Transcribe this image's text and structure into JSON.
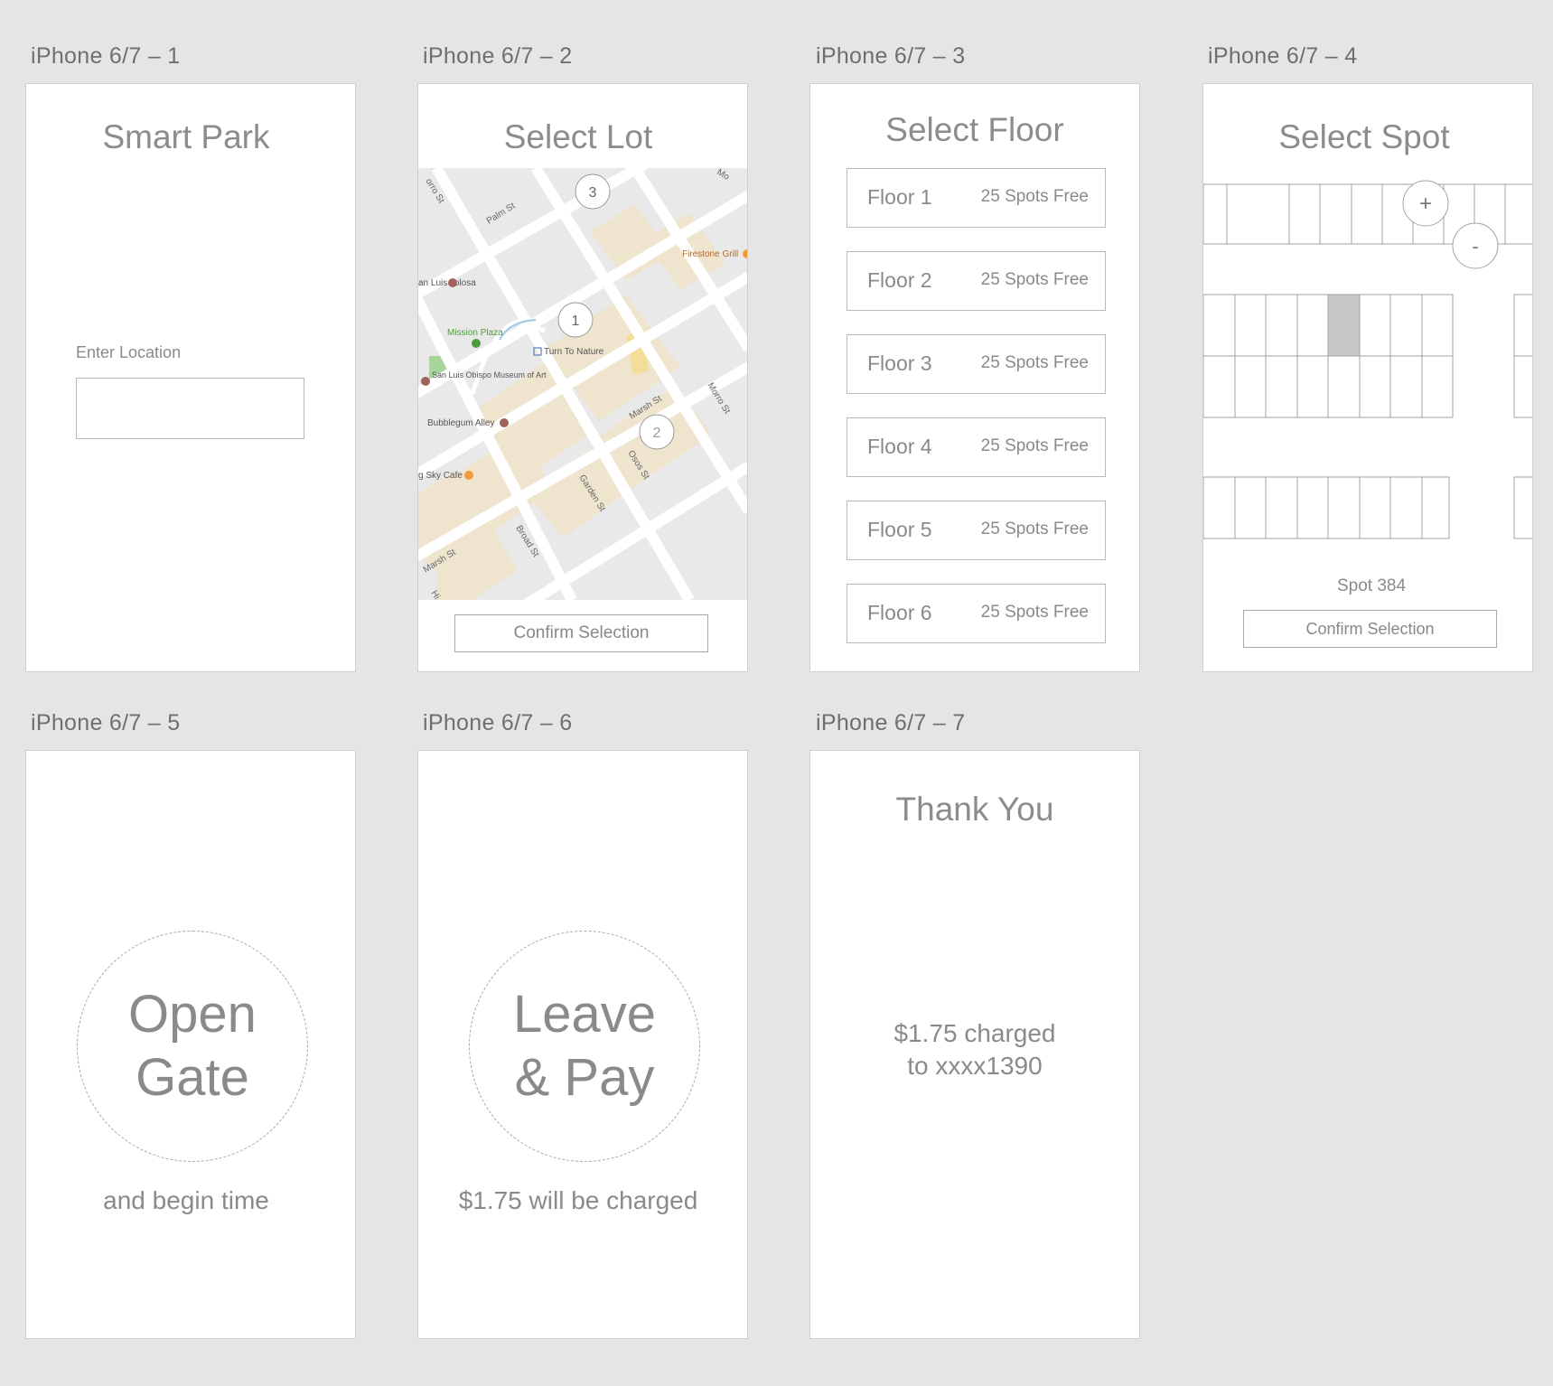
{
  "frames": {
    "f1": {
      "label": "iPhone 6/7 – 1",
      "title": "Smart Park",
      "location_label": "Enter Location",
      "location_value": ""
    },
    "f2": {
      "label": "iPhone 6/7 – 2",
      "title": "Select Lot",
      "confirm": "Confirm Selection",
      "map": {
        "lot_markers": [
          "3",
          "1",
          "2"
        ],
        "street_labels": [
          "orro St",
          "Palm St",
          "Mo",
          "Marsh St",
          "Morro St",
          "Garden St",
          "Broad St",
          "Osos St",
          "Marsh St",
          "Hi"
        ],
        "places": [
          "Firestone Grill",
          "an Luis Tolosa",
          "Mission Plaza",
          "Turn To Nature",
          "San Luis Obispo Museum of Art",
          "Bubblegum Alley",
          "g Sky Cafe"
        ]
      }
    },
    "f3": {
      "label": "iPhone 6/7 – 3",
      "title": "Select Floor",
      "floors": [
        {
          "name": "Floor 1",
          "free": "25 Spots Free"
        },
        {
          "name": "Floor 2",
          "free": "25 Spots Free"
        },
        {
          "name": "Floor 3",
          "free": "25 Spots Free"
        },
        {
          "name": "Floor 4",
          "free": "25 Spots Free"
        },
        {
          "name": "Floor 5",
          "free": "25 Spots Free"
        },
        {
          "name": "Floor 6",
          "free": "25 Spots Free"
        }
      ]
    },
    "f4": {
      "label": "iPhone 6/7 – 4",
      "title": "Select Spot",
      "zoom_in": "+",
      "zoom_out": "-",
      "spot": "Spot 384",
      "confirm": "Confirm Selection"
    },
    "f5": {
      "label": "iPhone 6/7 – 5",
      "button": "Open\nGate",
      "subtext": "and begin time"
    },
    "f6": {
      "label": "iPhone 6/7 – 6",
      "button": "Leave\n& Pay",
      "subtext": "$1.75 will be charged"
    },
    "f7": {
      "label": "iPhone 6/7 – 7",
      "title": "Thank You",
      "message": "$1.75 charged\nto xxxx1390"
    }
  },
  "colors": {
    "background": "#e5e5e5",
    "frame": "#ffffff",
    "selected_spot": "#c8c8c8",
    "map_block": "#f0e6d2",
    "map_road": "#ffffff",
    "map_ground": "#e8e8e8"
  }
}
